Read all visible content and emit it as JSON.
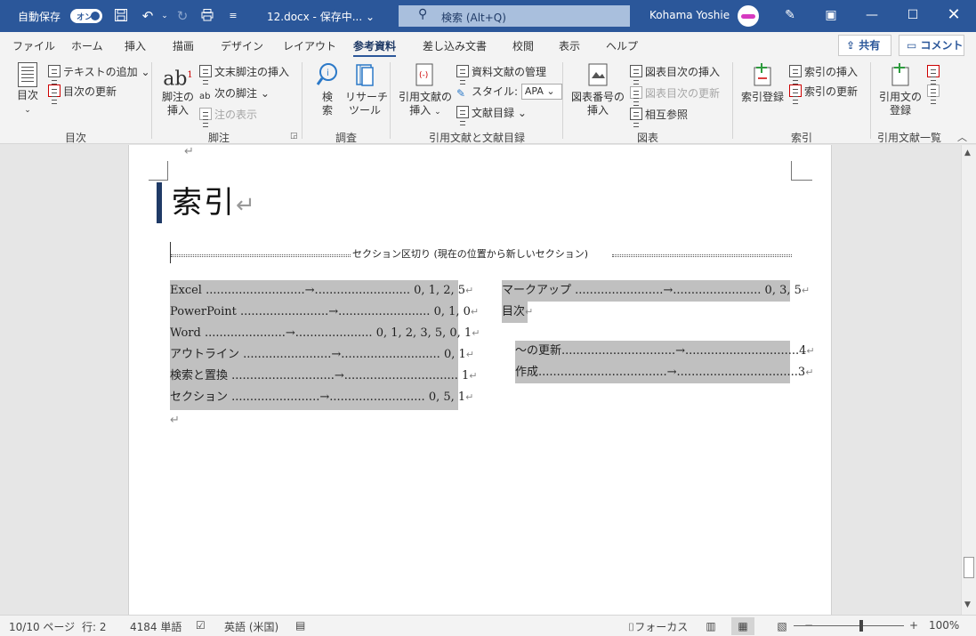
{
  "titlebar": {
    "autosave_label": "自動保存",
    "autosave_state": "オン",
    "filename": "12.docx - 保存中... ⌄",
    "search_placeholder": "検索 (Alt+Q)",
    "user_name": "Kohama Yoshie",
    "bg_color": "#2b579a"
  },
  "tabs": [
    "ファイル",
    "ホーム",
    "挿入",
    "描画",
    "デザイン",
    "レイアウト",
    "参考資料",
    "差し込み文書",
    "校閲",
    "表示",
    "ヘルプ"
  ],
  "active_tab": "参考資料",
  "share_label": "共有",
  "comment_label": "コメント",
  "ribbon": {
    "toc": {
      "label": "目次",
      "big": "目次",
      "add_text": "テキストの追加",
      "update": "目次の更新"
    },
    "footnotes": {
      "label": "脚注",
      "insert_big_1": "脚注の",
      "insert_big_2": "挿入",
      "endnote": "文末脚注の挿入",
      "next": "次の脚注",
      "show": "注の表示",
      "ab_glyph": "ab",
      "sup": "1"
    },
    "research": {
      "label": "調査",
      "search_1": "検",
      "search_2": "索",
      "researcher_1": "リサーチ",
      "researcher_2": "ツール"
    },
    "citations": {
      "label": "引用文献と文献目録",
      "insert_1": "引用文献の",
      "insert_2": "挿入",
      "manage": "資料文献の管理",
      "style_label": "スタイル:",
      "style_value": "APA",
      "bibliography": "文献目録"
    },
    "captions": {
      "label": "図表",
      "insert_1": "図表番号の",
      "insert_2": "挿入",
      "table_of_figures": "図表目次の挿入",
      "update_tof": "図表目次の更新",
      "cross_ref": "相互参照"
    },
    "index": {
      "label": "索引",
      "mark": "索引登録",
      "insert": "索引の挿入",
      "update": "索引の更新"
    },
    "toa": {
      "label": "引用文献一覧",
      "mark_1": "引用文の",
      "mark_2": "登録"
    }
  },
  "document": {
    "heading": "索引",
    "section_break": "セクション区切り (現在の位置から新しいセクション)",
    "left_entries": [
      {
        "term": "Excel",
        "dots": "...........................→..........................",
        "pages": "0, 1, 2, 5"
      },
      {
        "term": "PowerPoint",
        "dots": "........................→.........................",
        "pages": "0, 1, 0"
      },
      {
        "term": "Word",
        "dots": "......................→.....................",
        "pages": "0, 1, 2, 3, 5, 0, 1"
      },
      {
        "term": "アウトライン",
        "dots": "........................→...........................",
        "pages": "0, 1"
      },
      {
        "term": "検索と置換",
        "dots": "............................→...............................",
        "pages": "1"
      },
      {
        "term": "セクション",
        "dots": "........................→..........................",
        "pages": "0, 5, 1"
      }
    ],
    "right_entries": [
      {
        "term": "マークアップ",
        "dots": "........................→........................",
        "pages": "0, 3, 5"
      },
      {
        "term": "目次",
        "dots": "",
        "pages": ""
      }
    ],
    "right_sub_entries": [
      {
        "term": "～の更新",
        "dots": "...............................→...............................",
        "pages": "4"
      },
      {
        "term": "作成",
        "dots": "...................................→.................................",
        "pages": "3"
      }
    ],
    "para_mark": "↵"
  },
  "status": {
    "page": "10/10 ページ",
    "line": "行: 2",
    "words": "4184 単語",
    "language": "英語 (米国)",
    "focus": "フォーカス",
    "zoom": "100%",
    "zoom_minus": "−",
    "zoom_plus": "+"
  }
}
